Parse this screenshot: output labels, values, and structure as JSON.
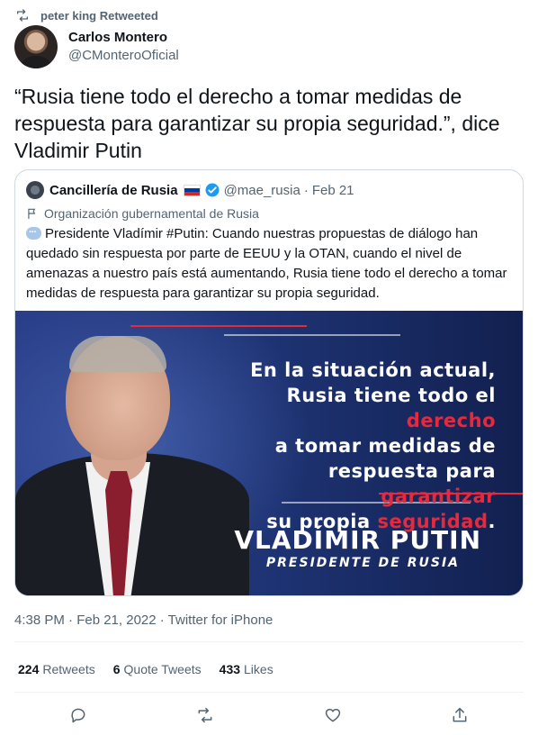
{
  "retweet_bar": {
    "icon": "retweet-icon",
    "text": "peter king Retweeted"
  },
  "author": {
    "name": "Carlos Montero",
    "handle": "@CMonteroOficial",
    "avatar": "avatar-photo"
  },
  "tweet": {
    "text": "“Rusia tiene todo el derecho a tomar medidas de respuesta para garantizar su propia seguridad.”, dice Vladimir Putin"
  },
  "quoted": {
    "name": "Cancillería de Rusia",
    "flag_colors": [
      "#ffffff",
      "#0039a6",
      "#d52b1e"
    ],
    "verified_color": "#1d9bf0",
    "handle": "@mae_rusia",
    "dot": "·",
    "date": "Feb 21",
    "label": "Organización gubernamental de Rusia",
    "text": "Presidente Vladímir #Putin: Cuando nuestras propuestas de diálogo han quedado sin respuesta por parte de EEUU y la OTAN, cuando el nivel de amenazas a nuestro país está aumentando, Rusia tiene todo el derecho a tomar medidas de respuesta para garantizar su propia seguridad.",
    "image": {
      "lines": [
        {
          "a": "En la situación actual,"
        },
        {
          "a": "Rusia tiene todo el ",
          "b": "derecho"
        },
        {
          "a": "a tomar medidas de"
        },
        {
          "a": "respuesta para ",
          "b": "garantizar"
        },
        {
          "a": "su propia ",
          "b": "seguridad",
          "c": "."
        }
      ],
      "name": "VLADÍMIR PUTIN",
      "title": "PRESIDENTE DE RUSIA",
      "accent_color": "#e8283b"
    }
  },
  "meta": {
    "text": "4:38 PM · Feb 21, 2022 · Twitter for iPhone"
  },
  "stats": {
    "retweets_count": "224",
    "retweets_label": "Retweets",
    "quotes_count": "6",
    "quotes_label": "Quote Tweets",
    "likes_count": "433",
    "likes_label": "Likes"
  },
  "actions": [
    "reply-icon",
    "retweet-icon",
    "like-icon",
    "share-icon"
  ]
}
